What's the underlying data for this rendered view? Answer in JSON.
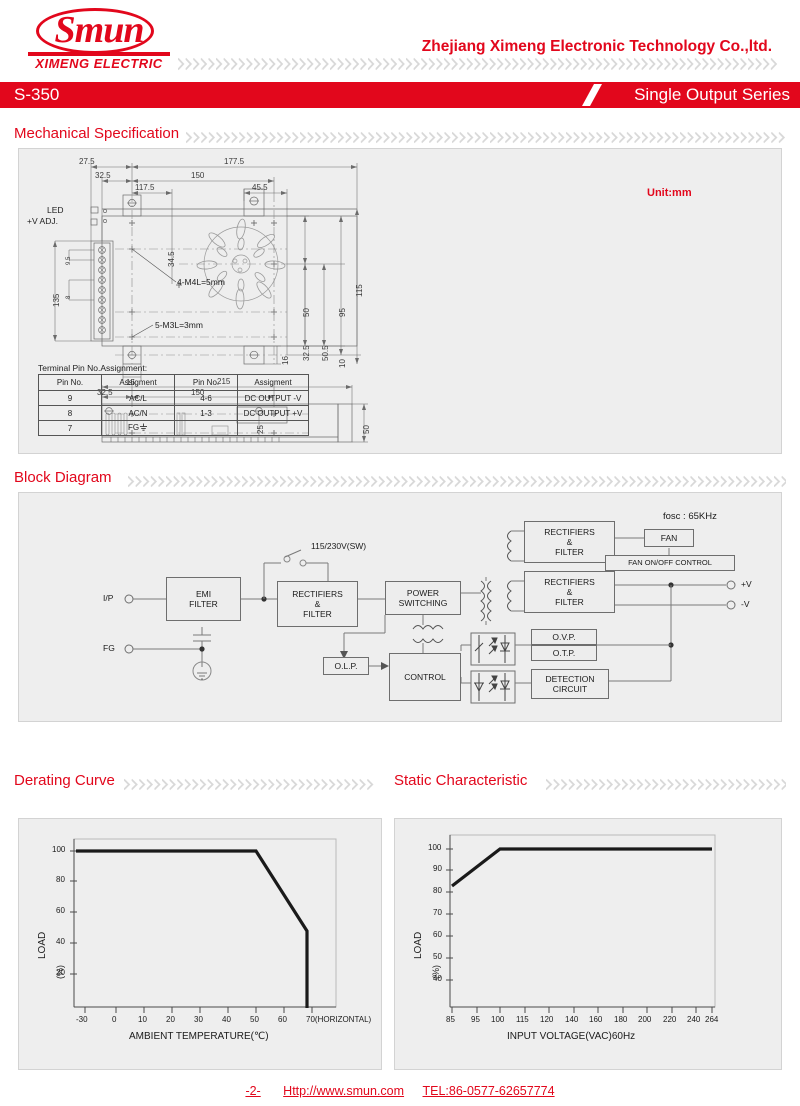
{
  "header": {
    "logo_word": "Smun",
    "logo_sub": "XIMENG ELECTRIC",
    "company": "Zhejiang Ximeng Electronic Technology Co.,ltd.",
    "model": "S-350",
    "series": "Single Output Series"
  },
  "sections": {
    "mechanical": "Mechanical Specification",
    "block": "Block Diagram",
    "derating": "Derating Curve",
    "static": "Static Characteristic"
  },
  "mechanical": {
    "unit": "Unit:mm",
    "labels": {
      "led": "LED",
      "vadj": "+V ADJ.",
      "screw_m4": "4-M4L=5mm",
      "screw_m3": "5-M3L=3mm"
    },
    "dims_top": {
      "d1": "27.5",
      "d2": "177.5",
      "d3": "32.5",
      "d4": "150",
      "d5": "117.5",
      "d6": "45.5",
      "d7": "34.5"
    },
    "dims_right": {
      "r1": "50",
      "r2": "95",
      "r3": "115",
      "r4": "32.5",
      "r5": "50.5",
      "r6": "10"
    },
    "dims_left": {
      "l1": "135",
      "l2": "9.5",
      "l3": "8"
    },
    "dims_bottom": {
      "b1": "15",
      "b2": "16"
    },
    "dims_side": {
      "s1": "215",
      "s2": "32.5",
      "s3": "150",
      "s4": "25",
      "s5": "50"
    },
    "pin_table": {
      "caption": "Terminal Pin No.Assignment:",
      "headers": [
        "Pin No.",
        "Assigment",
        "Pin No.",
        "Assigment"
      ],
      "rows": [
        [
          "9",
          "AC/L",
          "4-6",
          "DC OUTPUT -V"
        ],
        [
          "8",
          "AC/N",
          "1-3",
          "DC OUTPUT +V"
        ],
        [
          "7",
          "FG",
          "",
          ""
        ]
      ]
    }
  },
  "block_diagram": {
    "input_ip": "I/P",
    "input_fg": "FG",
    "emi_filter": "EMI\nFILTER",
    "sw_label": "115/230V(SW)",
    "rect_filter_1": "RECTIFIERS\n&\nFILTER",
    "power_switching": "POWER\nSWITCHING",
    "rect_filter_2": "RECTIFIERS\n&\nFILTER",
    "rect_filter_3": "RECTIFIERS\n&\nFILTER",
    "fan": "FAN",
    "fan_control": "FAN ON/OFF CONTROL",
    "olp": "O.L.P.",
    "control": "CONTROL",
    "ovp": "O.V.P.",
    "otp": "O.T.P.",
    "detection": "DETECTION\nCIRCUIT",
    "out_pos": "+V",
    "out_neg": "-V",
    "fosc": "fosc : 65KHz"
  },
  "chart_data": [
    {
      "type": "line",
      "title": "Derating Curve",
      "xlabel": "AMBIENT TEMPERATURE(℃)",
      "ylabel": "LOAD",
      "ylabel2": "(%)",
      "xticks": [
        "-30",
        "0",
        "10",
        "20",
        "30",
        "40",
        "50",
        "60",
        "70(HORIZONTAL)"
      ],
      "xtick_values": [
        -30,
        0,
        10,
        20,
        30,
        40,
        50,
        60,
        70
      ],
      "yticks": [
        "20",
        "40",
        "60",
        "80",
        "100"
      ],
      "ytick_values": [
        20,
        40,
        60,
        80,
        100
      ],
      "xlim": [
        -30,
        75
      ],
      "ylim": [
        0,
        110
      ],
      "grid": false,
      "x": [
        -30,
        50,
        68,
        68
      ],
      "values": [
        100,
        100,
        50,
        0
      ]
    },
    {
      "type": "line",
      "title": "Static Characteristic",
      "xlabel": "INPUT VOLTAGE(VAC)60Hz",
      "ylabel": "LOAD",
      "ylabel2": "(%)",
      "xticks": [
        "85",
        "95",
        "100",
        "115",
        "120",
        "140",
        "160",
        "180",
        "200",
        "220",
        "240",
        "264"
      ],
      "xtick_values": [
        85,
        95,
        100,
        115,
        120,
        140,
        160,
        180,
        200,
        220,
        240,
        264
      ],
      "yticks": [
        "40",
        "50",
        "60",
        "70",
        "80",
        "90",
        "100"
      ],
      "ytick_values": [
        40,
        50,
        60,
        70,
        80,
        90,
        100
      ],
      "xlim": [
        80,
        275
      ],
      "ylim": [
        33,
        107
      ],
      "grid": false,
      "x": [
        85,
        100,
        264
      ],
      "values": [
        83,
        100,
        100
      ]
    }
  ],
  "footer": {
    "page": "-2-",
    "website": "Http://www.smun.com",
    "tel": "TEL:86-0577-62657774"
  }
}
